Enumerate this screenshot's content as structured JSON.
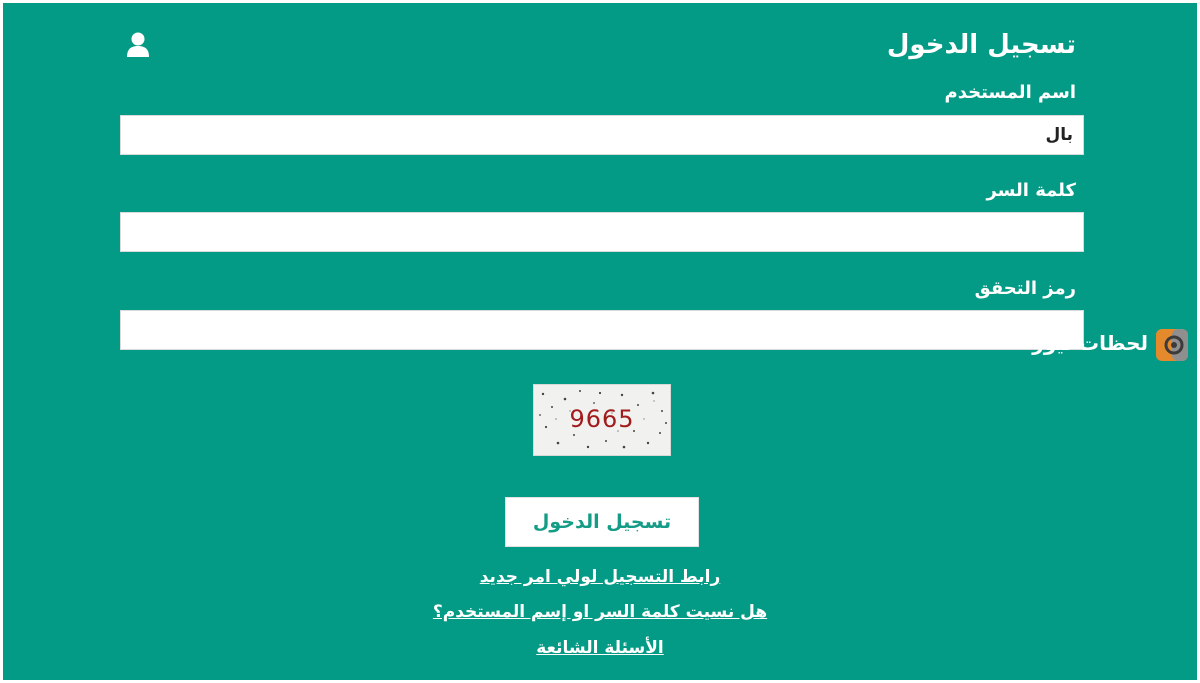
{
  "header": {
    "title": "تسجيل الدخول",
    "user_icon": "user-icon"
  },
  "form": {
    "username_label": "اسم المستخدم",
    "username_value": "بال",
    "password_label": "كلمة السر",
    "password_value": "",
    "captcha_label": "رمز التحقق",
    "captcha_value": "",
    "captcha_code": "9665",
    "submit_label": "تسجيل الدخول"
  },
  "links": {
    "register_parent": "رابط التسجيل لولي امر جديد",
    "forgot": "هل نسيت كلمة السر او إسم المستخدم؟",
    "faq": "الأسئلة الشائعة"
  },
  "watermark": {
    "text": "لحظات نيوز"
  },
  "colors": {
    "background": "#049b86",
    "button_text": "#159c86",
    "captcha_text": "#a11c1c"
  }
}
